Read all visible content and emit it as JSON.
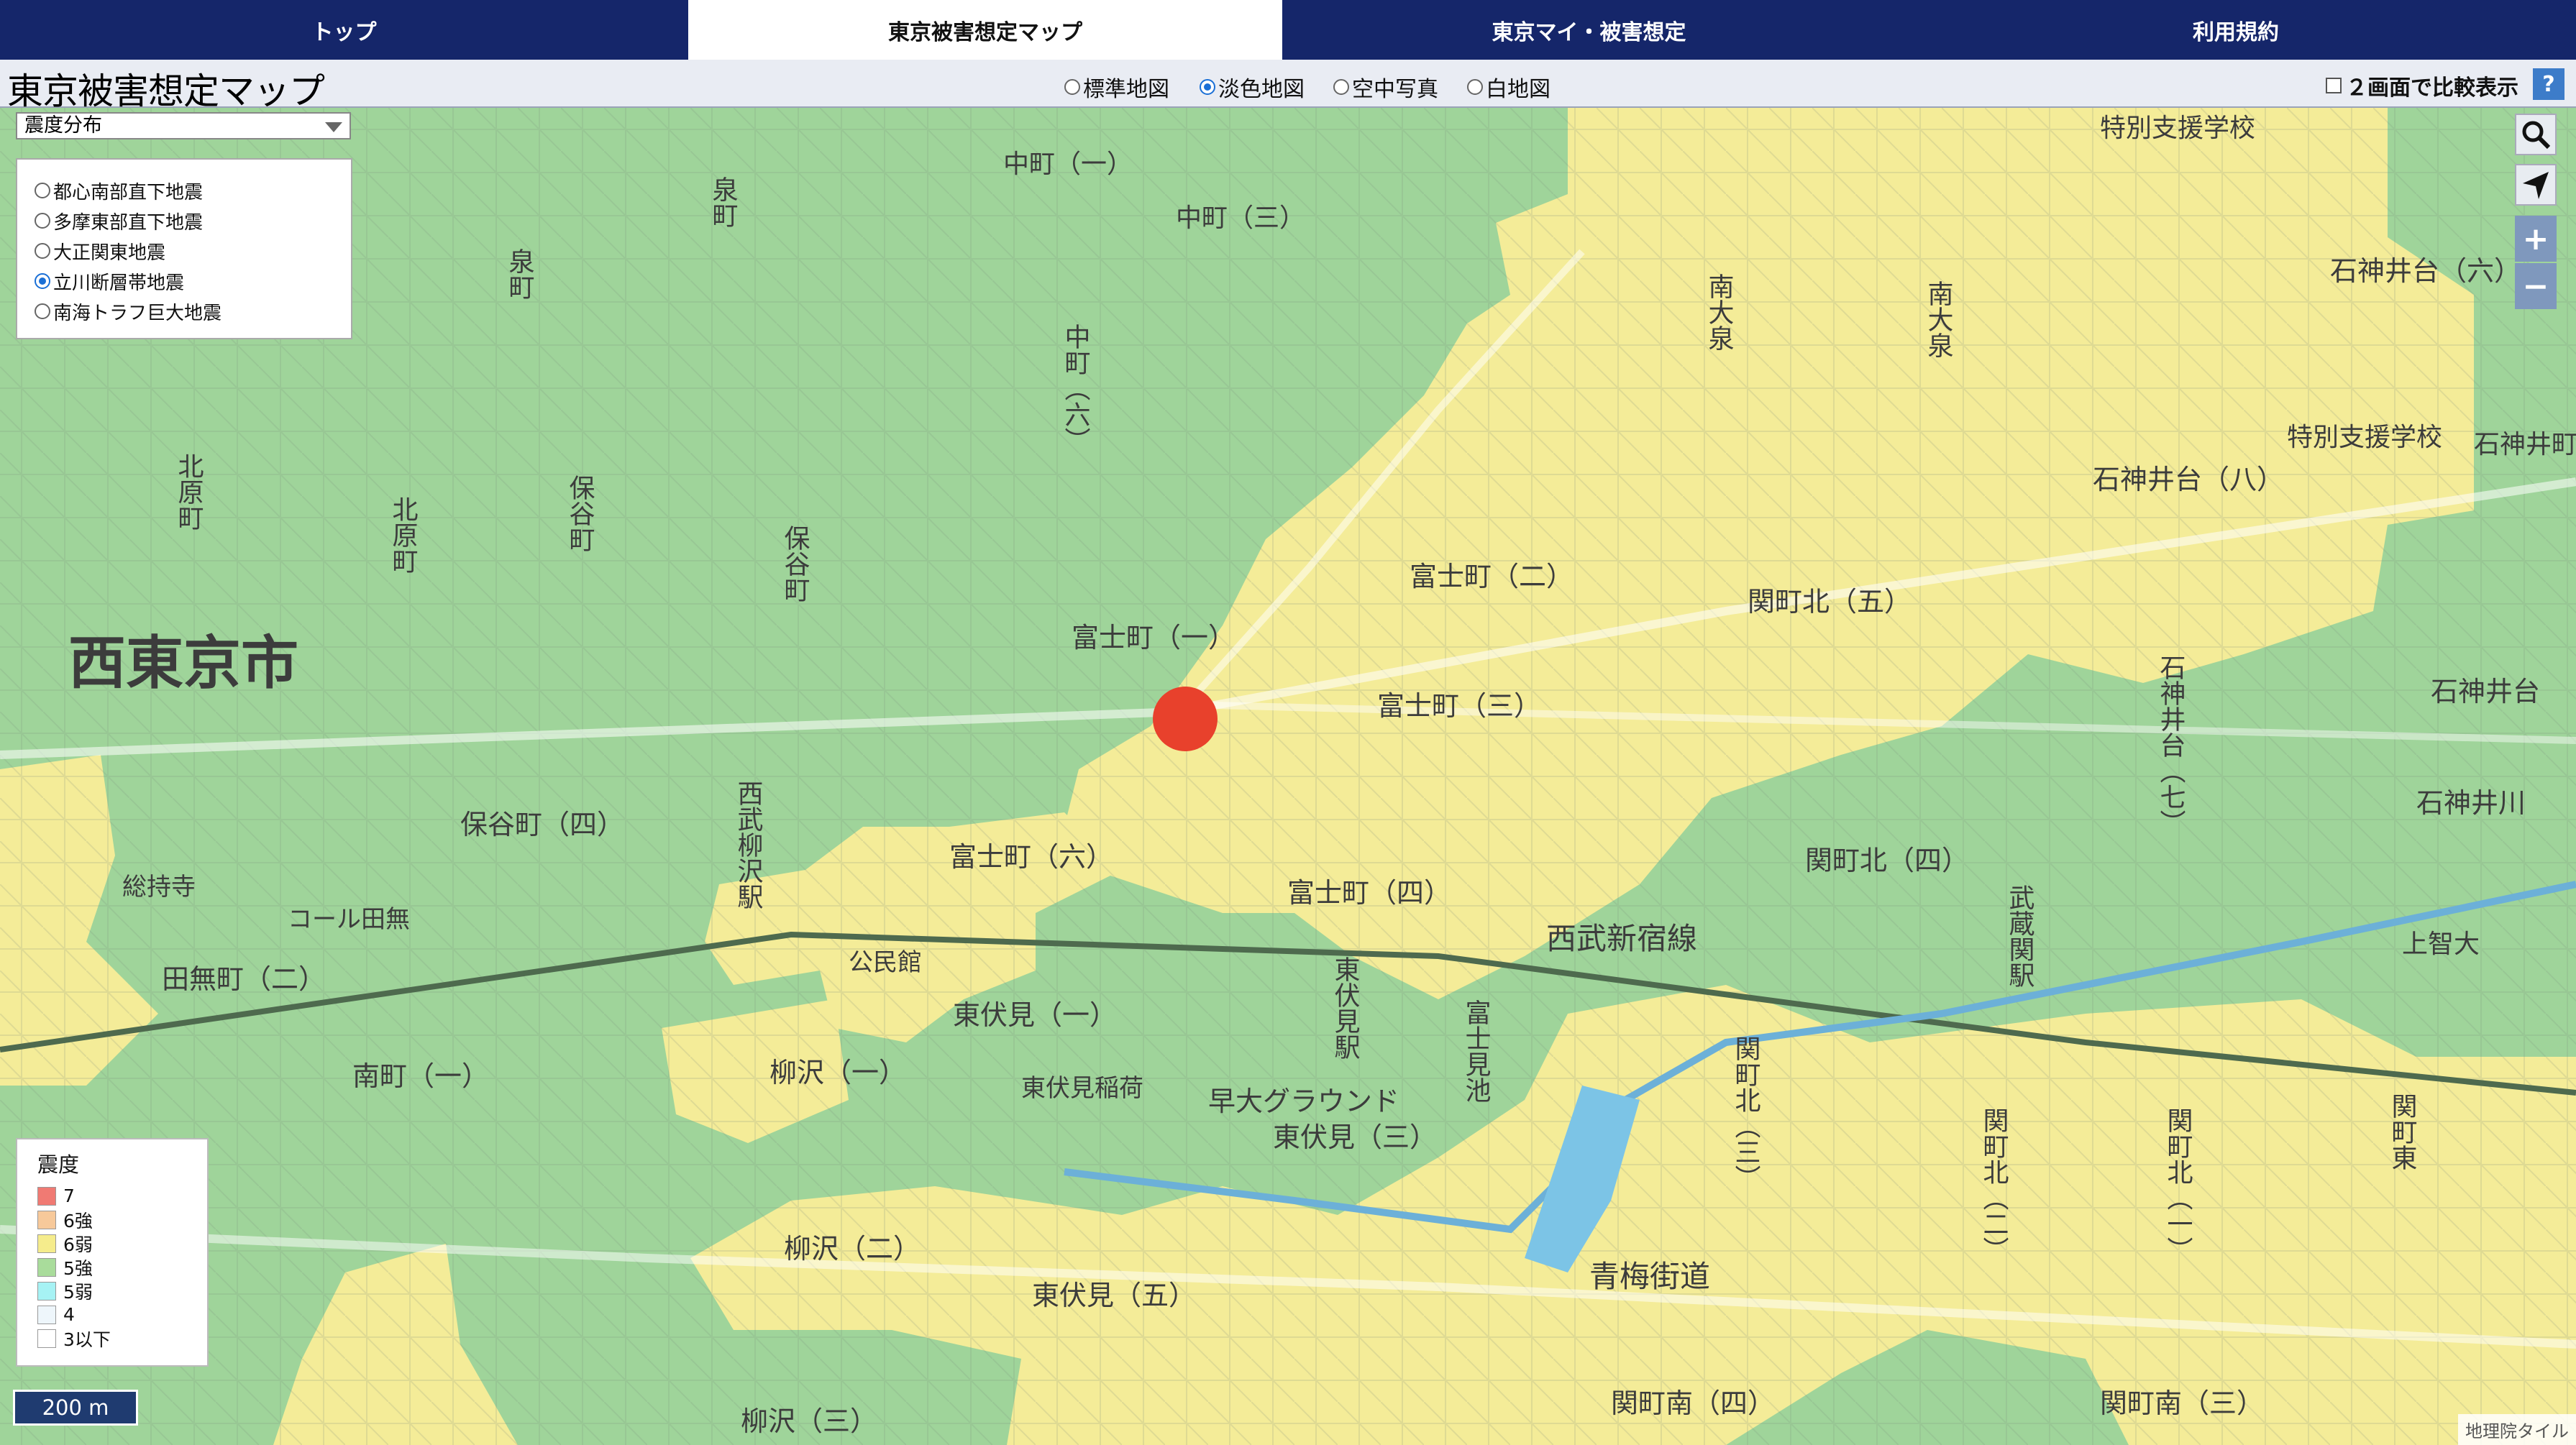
{
  "nav": {
    "tabs": [
      {
        "label": "トップ"
      },
      {
        "label": "東京被害想定マップ"
      },
      {
        "label": "東京マイ・被害想定"
      },
      {
        "label": "利用規約"
      }
    ]
  },
  "toolbar": {
    "logo": "東京被害想定マップ",
    "basemaps": [
      {
        "label": "標準地図",
        "selected": false
      },
      {
        "label": "淡色地図",
        "selected": true
      },
      {
        "label": "空中写真",
        "selected": false
      },
      {
        "label": "白地図",
        "selected": false
      }
    ],
    "compare_label": "２画面で比較表示",
    "help_label": "?"
  },
  "layer_select": {
    "value": "震度分布",
    "options": [
      {
        "label": "都心南部直下地震",
        "selected": false
      },
      {
        "label": "多摩東部直下地震",
        "selected": false
      },
      {
        "label": "大正関東地震",
        "selected": false
      },
      {
        "label": "立川断層帯地震",
        "selected": true
      },
      {
        "label": "南海トラフ巨大地震",
        "selected": false
      }
    ]
  },
  "controls": {
    "search": "search-icon",
    "locate": "locate-arrow-icon",
    "zoom_in": "+",
    "zoom_out": "−"
  },
  "legend": {
    "title": "震度",
    "items": [
      {
        "label": "7",
        "color": "#f07a73"
      },
      {
        "label": "6強",
        "color": "#f7c99a"
      },
      {
        "label": "6弱",
        "color": "#f5ec8c"
      },
      {
        "label": "5強",
        "color": "#a9dc9b"
      },
      {
        "label": "5弱",
        "color": "#a6f2f4"
      },
      {
        "label": "4",
        "color": "#eef6fb"
      },
      {
        "label": "3以下",
        "color": "#ffffff"
      }
    ]
  },
  "scale": "200 m",
  "attribution": "地理院タイル",
  "colors": {
    "zone_5strong": "#9fd49a",
    "zone_6weak": "#f4ec98",
    "marker": "#e8412c",
    "nav_bg": "#15266a"
  },
  "map_labels": {
    "city": "西東京市",
    "l01": "富士町（一）",
    "l02": "富士町（二）",
    "l03": "富士町（三）",
    "l04": "富士町（四）",
    "l05": "富士町（六）",
    "l06": "保谷町（四）",
    "l07": "関町北（五）",
    "l08": "関町北（四）",
    "l09": "東伏見（一）",
    "l10": "東伏見（三）",
    "l11": "東伏見（五）",
    "l12": "東伏見稲荷",
    "l13": "早大グラウンド",
    "l14": "柳沢（一）",
    "l15": "柳沢（二）",
    "l16": "柳沢（三）",
    "l17": "南町（一）",
    "l18": "田無町（二）",
    "l19": "総持寺",
    "l20": "コール田無",
    "l21": "公民館",
    "l22": "西武新宿線",
    "l23": "青梅街道",
    "l24": "関町南（四）",
    "l25": "関町南（三）",
    "l26": "石神井台（八）",
    "l27": "石神井台（六）",
    "l28": "石神井台",
    "l29": "石神井川",
    "l30": "特別支援学校",
    "l31": "上智大",
    "l32": "中町（一）",
    "l33": "中町（三）",
    "l34": "北原町",
    "l35": "保谷町",
    "l36": "南大泉",
    "l37": "武蔵関駅",
    "l38": "東伏見駅",
    "l39": "西武柳沢駅",
    "l40": "富士見池",
    "l41": "泉町",
    "l42": "中町（六）",
    "l43": "関町北（三）",
    "l44": "関町北（二）",
    "l45": "関町北（一）",
    "l46": "関町東",
    "l47": "石神井町",
    "l48": "石神井台（七）"
  }
}
